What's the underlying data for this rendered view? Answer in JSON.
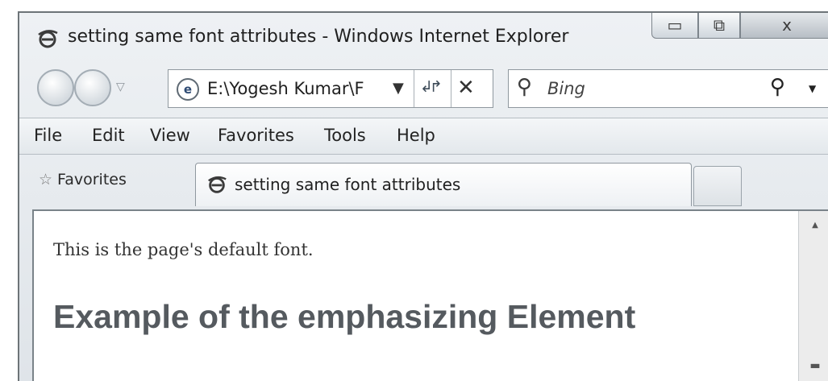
{
  "window": {
    "title": "setting same font attributes - Windows Internet Explorer",
    "controls": {
      "minimize": "▭",
      "maximize": "⧉",
      "close": "x"
    }
  },
  "nav": {
    "address": "E:\\Yogesh Kumar\\F",
    "address_dropdown": "▼",
    "refresh": "↲↱",
    "stop": "✕",
    "search_placeholder": "Bing",
    "search_dropdown": "▼"
  },
  "menu": [
    "File",
    "Edit",
    "View",
    "Favorites",
    "Tools",
    "Help"
  ],
  "favorites": {
    "label": "Favorites",
    "tab_title": "setting same font attributes"
  },
  "content": {
    "default_text": "This is the page's default font.",
    "heading": "Example of the emphasizing Element"
  },
  "colors": {
    "ie_blue": "#2d5fa8",
    "heading": "#555a5f"
  }
}
